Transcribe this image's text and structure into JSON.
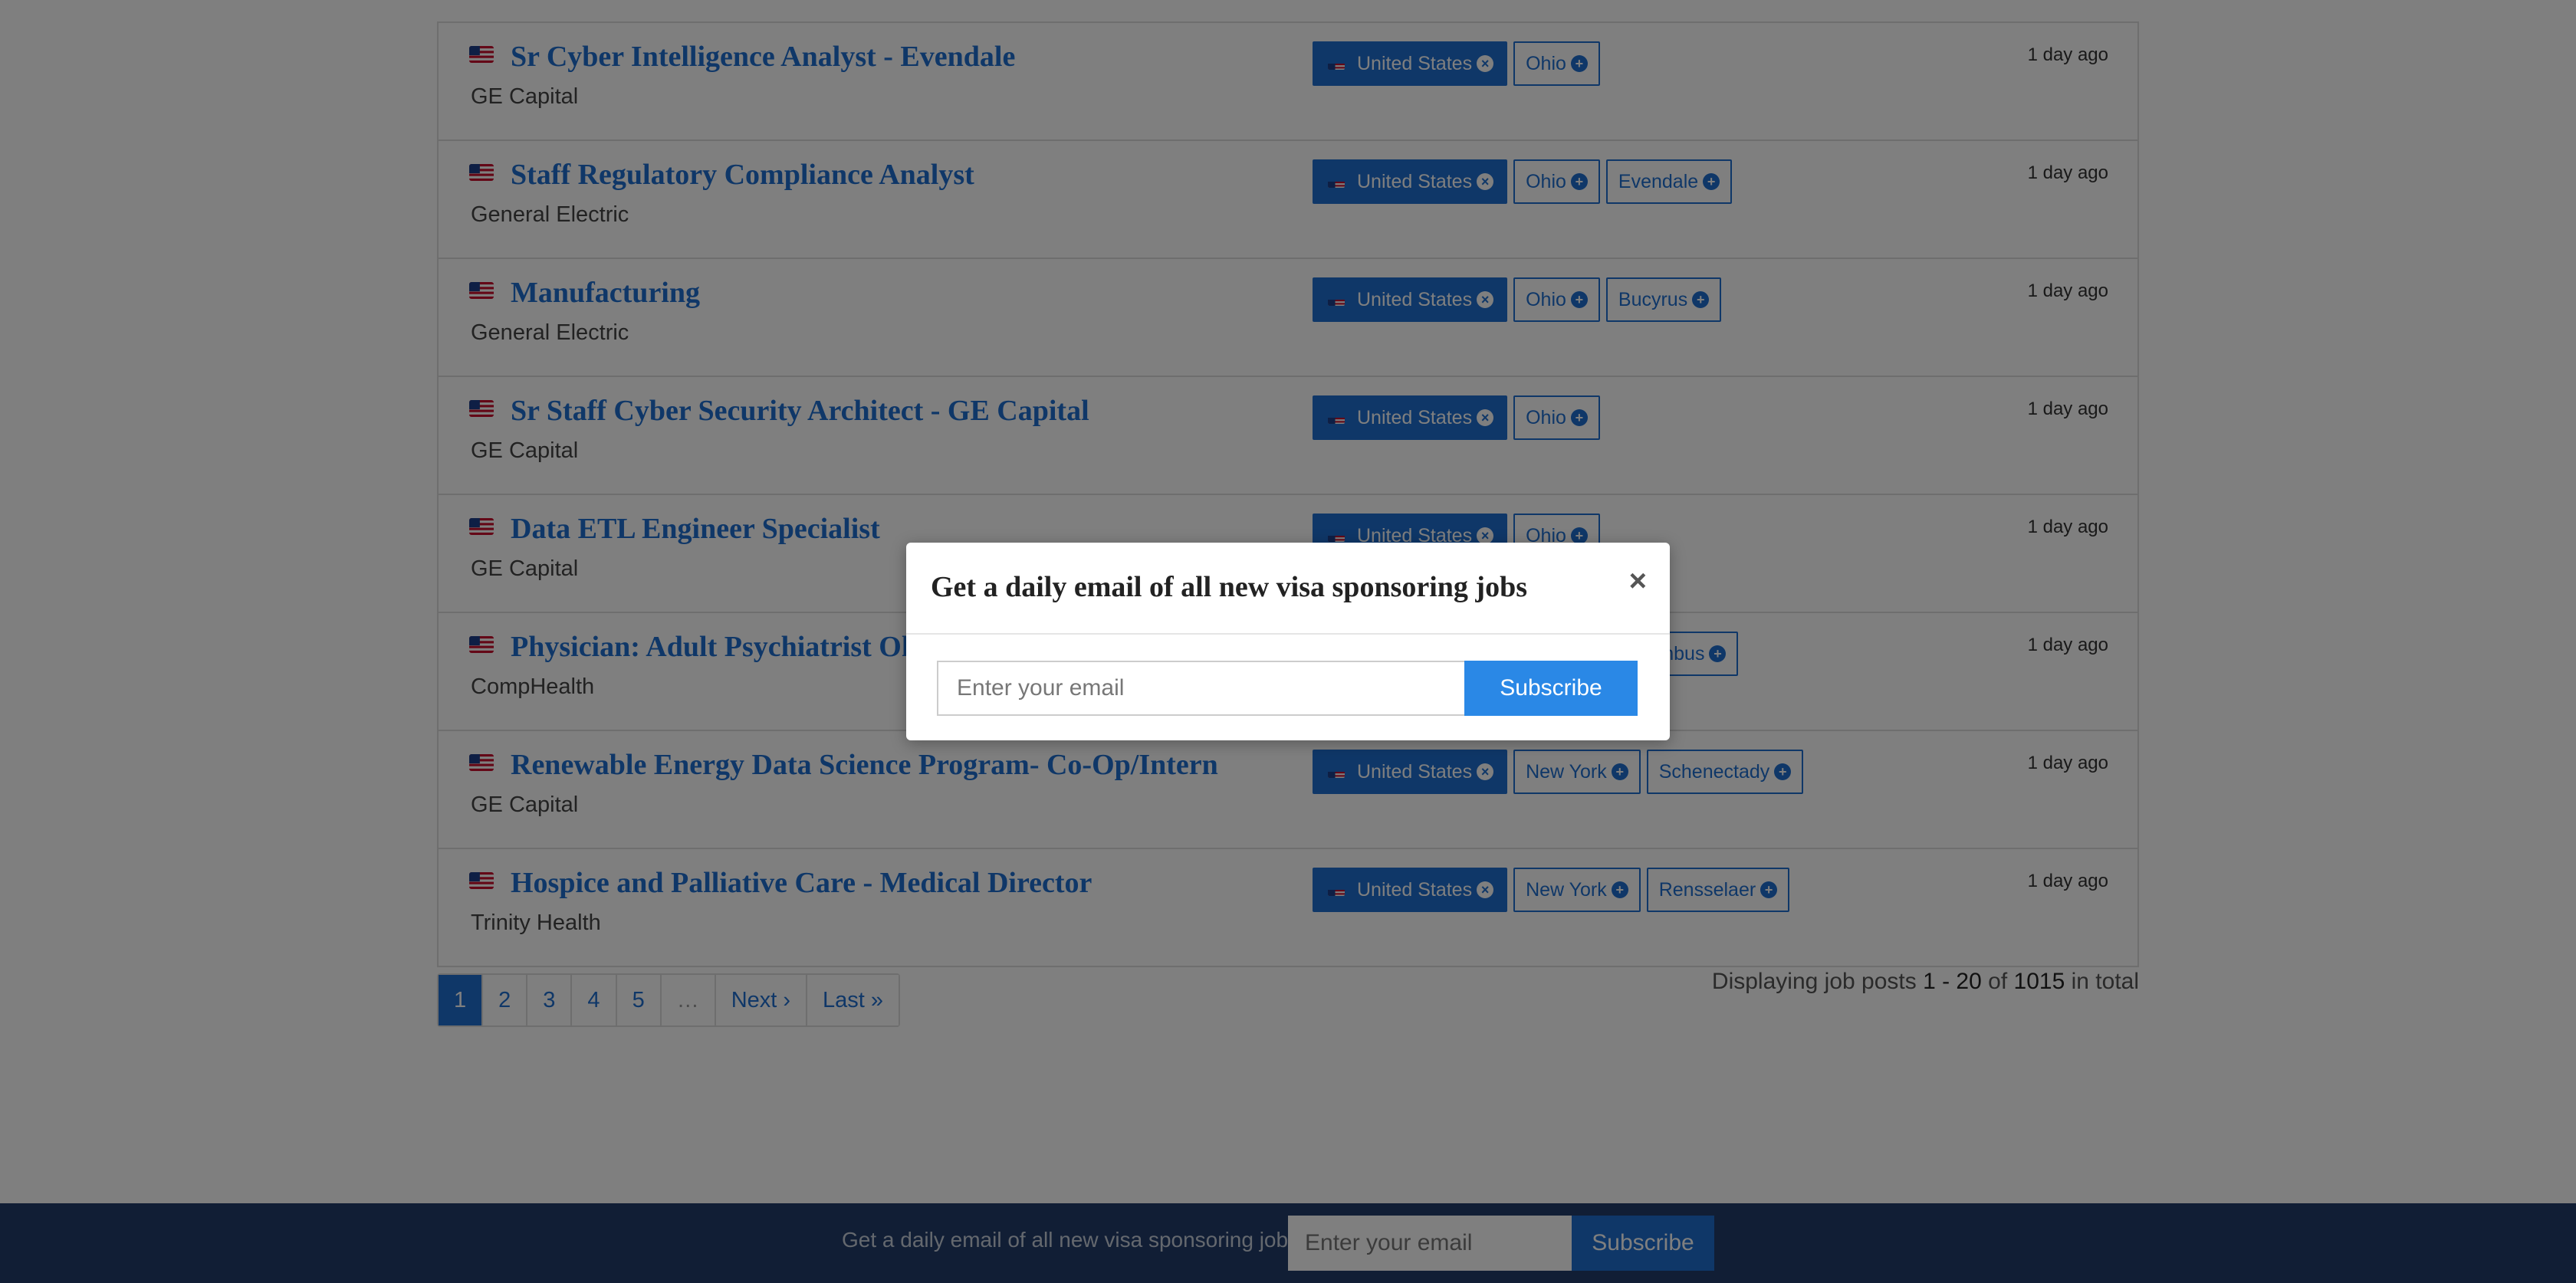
{
  "jobs": [
    {
      "title": "Sr Cyber Intelligence Analyst - Evendale",
      "company": "GE Capital",
      "country": "United States",
      "tags": [
        "Ohio"
      ],
      "date": "1 day ago"
    },
    {
      "title": "Staff Regulatory Compliance Analyst",
      "company": "General Electric",
      "country": "United States",
      "tags": [
        "Ohio",
        "Evendale"
      ],
      "date": "1 day ago"
    },
    {
      "title": "Manufacturing",
      "company": "General Electric",
      "country": "United States",
      "tags": [
        "Ohio",
        "Bucyrus"
      ],
      "date": "1 day ago"
    },
    {
      "title": "Sr Staff Cyber Security Architect - GE Capital",
      "company": "GE Capital",
      "country": "United States",
      "tags": [
        "Ohio"
      ],
      "date": "1 day ago"
    },
    {
      "title": "Data ETL Engineer Specialist",
      "company": "GE Capital",
      "country": "United States",
      "tags": [
        "Ohio"
      ],
      "date": "1 day ago"
    },
    {
      "title": "Physician: Adult Psychiatrist Ohio",
      "company": "CompHealth",
      "country": "United States",
      "tags": [
        "Ohio",
        "Columbus"
      ],
      "date": "1 day ago"
    },
    {
      "title": "Renewable Energy Data Science Program- Co-Op/Intern",
      "company": "GE Capital",
      "country": "United States",
      "tags": [
        "New York",
        "Schenectady"
      ],
      "date": "1 day ago"
    },
    {
      "title": "Hospice and Palliative Care - Medical Director",
      "company": "Trinity Health",
      "country": "United States",
      "tags": [
        "New York",
        "Rensselaer"
      ],
      "date": "1 day ago"
    }
  ],
  "pagination": {
    "pages": [
      "1",
      "2",
      "3",
      "4",
      "5"
    ],
    "ellipsis": "…",
    "next": "Next ›",
    "last": "Last »",
    "active": "1"
  },
  "display": {
    "prefix": "Displaying job posts",
    "range": "1 - 20",
    "of": "of",
    "total": "1015",
    "suffix": "in total"
  },
  "footer": {
    "text": "Get a daily email of all new visa sponsoring jobs",
    "placeholder": "Enter your email",
    "button": "Subscribe"
  },
  "modal": {
    "title": "Get a daily email of all new visa sponsoring jobs",
    "close": "×",
    "placeholder": "Enter your email",
    "button": "Subscribe"
  },
  "colors": {
    "accent": "#1f6fd0",
    "footer_bg": "#223d6b",
    "subscribe_button": "#2a88e6"
  },
  "icons": {
    "flag": "us-flag-icon",
    "remove": "times-circle-icon",
    "add": "plus-circle-icon"
  }
}
